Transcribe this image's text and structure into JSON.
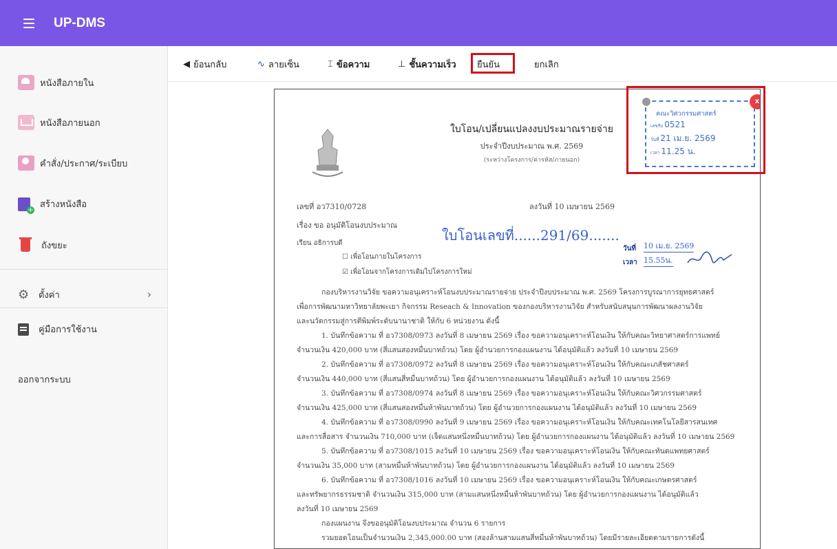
{
  "app": {
    "title": "UP-DMS"
  },
  "sidebar": {
    "items": [
      {
        "label": "หนังสือภายใน",
        "icon": "inbox-icon"
      },
      {
        "label": "หนังสือภายนอก",
        "icon": "outbox-icon"
      },
      {
        "label": "คำสั่ง/ประกาศ/ระเบียบ",
        "icon": "order-icon"
      },
      {
        "label": "สร้างหนังสือ",
        "icon": "create-document-icon"
      },
      {
        "label": "ถังขยะ",
        "icon": "trash-icon"
      },
      {
        "label": "ตั้งค่า",
        "icon": "gear-icon"
      },
      {
        "label": "คู่มือการใช้งาน",
        "icon": "manual-icon"
      }
    ],
    "logout_label": "ออกจากระบบ"
  },
  "toolbar": {
    "back_label": "ย้อนกลับ",
    "signature_label": "ลายเซ็น",
    "text_label": "ข้อความ",
    "urgency_label": "ชั้นความเร็ว",
    "confirm_label": "ยืนยัน",
    "cancel_label": "ยกเลิก"
  },
  "stamp": {
    "org": "คณะวิศวกรรมศาสตร์",
    "recv_label": "เลขรับ",
    "recv_no": "0521",
    "date_label": "วันที่",
    "date": "21 เม.ย. 2569",
    "time_label": "เวลา",
    "time": "11.25 น.",
    "close_label": "x"
  },
  "document": {
    "title": "ใบโอน/เปลี่ยนแปลงงบประมาณรายจ่าย",
    "fiscal_year": "ประจำปีงบประมาณ พ.ศ. 2569",
    "subtitle": "(ระหว่างโครงการ/ค่ารหัส/ภายนอก)",
    "doc_no": "เลขที่ อว7310/0728",
    "doc_date": "ลงวันที่ 10 เมษายน 2569",
    "subject": "เรื่อง ขอ อนุมัติโอนงบประมาณ",
    "to": "เรียน อธิการบดี",
    "check1": "เพื่อโอนภายในโครงการ",
    "check2": "เพื่อโอนจากโครงการเดิมไปโครงการใหม่",
    "handwritten_transfer": "ใบโอนเลขที่......291/69.......",
    "hand_date_label": "วันที่",
    "hand_date": "10 เม.ย. 2569",
    "hand_time_label": "เวลา",
    "hand_time": "15.55น.",
    "body": [
      "กองบริหารงานวิจัย ขอความอนุเคราะห์โอนงบประมาณรายจ่าย ประจำปีงบประมาณ พ.ศ. 2569 โครงการบูรณาการยุทธศาสตร์",
      "เพื่อการพัฒนามหาวิทยาลัยพะเยา กิจกรรม Reseach & Innovation ของกองบริหารงานวิจัย สำหรับสนับสนุนการพัฒนาผลงานวิจัย",
      "และนวัตกรรมสู่การตีพิมพ์ระดับนานาชาติ ให้กับ 6 หน่วยงาน ดังนี้",
      "1. บันทึกข้อความ ที่ อว7308/0973 ลงวันที่ 8 เมษายน 2569 เรื่อง ขอความอนุเคราะห์โอนเงิน ให้กับคณะวิทยาศาสตร์การแพทย์",
      "จำนวนเงิน 420,000 บาท (สี่แสนสองหมื่นบาทถ้วน) โดย ผู้อำนวยการกองแผนงาน ได้อนุมัติแล้ว ลงวันที่ 10 เมษายน 2569",
      "2. บันทึกข้อความ ที่ อว7308/0972 ลงวันที่ 8 เมษายน 2569 เรื่อง ขอความอนุเคราะห์โอนเงิน ให้กับคณะเภสัชศาสตร์",
      "จำนวนเงิน 440,000 บาท (สี่แสนสี่หมื่นบาทถ้วน) โดย ผู้อำนวยการกองแผนงาน ได้อนุมัติแล้ว ลงวันที่ 10 เมษายน 2569",
      "3. บันทึกข้อความ ที่ อว7308/0974 ลงวันที่ 8 เมษายน 2569 เรื่อง ขอความอนุเคราะห์โอนเงิน ให้กับคณะวิศวกรรมศาสตร์",
      "จำนวนเงิน 425,000 บาท (สี่แสนสองหมื่นห้าพันบาทถ้วน) โดย ผู้อำนวยการกองแผนงาน ได้อนุมัติแล้ว ลงวันที่ 10 เมษายน 2569",
      "4. บันทึกข้อความ ที่ อว7308/0990 ลงวันที่ 9 เมษายน 2569 เรื่อง ขอความอนุเคราะห์โอนเงิน ให้กับคณะเทคโนโลยีสารสนเทศ",
      "และการสื่อสาร จำนวนเงิน 710,000 บาท (เจ็ดแสนหนึ่งหมื่นบาทถ้วน) โดย ผู้อำนวยการกองแผนงาน ได้อนุมัติแล้ว ลงวันที่ 10 เมษายน 2569",
      "5. บันทึกข้อความ ที่ อว7308/1015 ลงวันที่ 10 เมษายน 2569 เรื่อง ขอความอนุเคราะห์โอนเงิน ให้กับคณะทันตแพทยศาสตร์",
      "จำนวนเงิน 35,000 บาท (สามหมื่นห้าพันบาทถ้วน) โดย ผู้อำนวยการกองแผนงาน ได้อนุมัติแล้ว ลงวันที่ 10 เมษายน 2569",
      "6. บันทึกข้อความ ที่ อว7308/1016 ลงวันที่ 10 เมษายน 2569 เรื่อง ขอความอนุเคราะห์โอนเงิน ให้กับคณะเกษตรศาสตร์",
      "และทรัพยากรธรรมชาติ จำนวนเงิน 315,000 บาท (สามแสนหนึ่งหมื่นห้าพันบาทถ้วน) โดย ผู้อำนวยการกองแผนงาน ได้อนุมัติแล้ว",
      "ลงวันที่ 10 เมษายน 2569",
      "กองแผนงาน จึงขออนุมัติโอนงบประมาณ จำนวน 6 รายการ",
      "รวมยอดโอนเป็นจำนวนเงิน 2,345,000.00 บาท (สองล้านสามแสนสี่หมื่นห้าพันบาทถ้วน) โดยมีรายละเอียดตามรายการดังนี้"
    ]
  }
}
